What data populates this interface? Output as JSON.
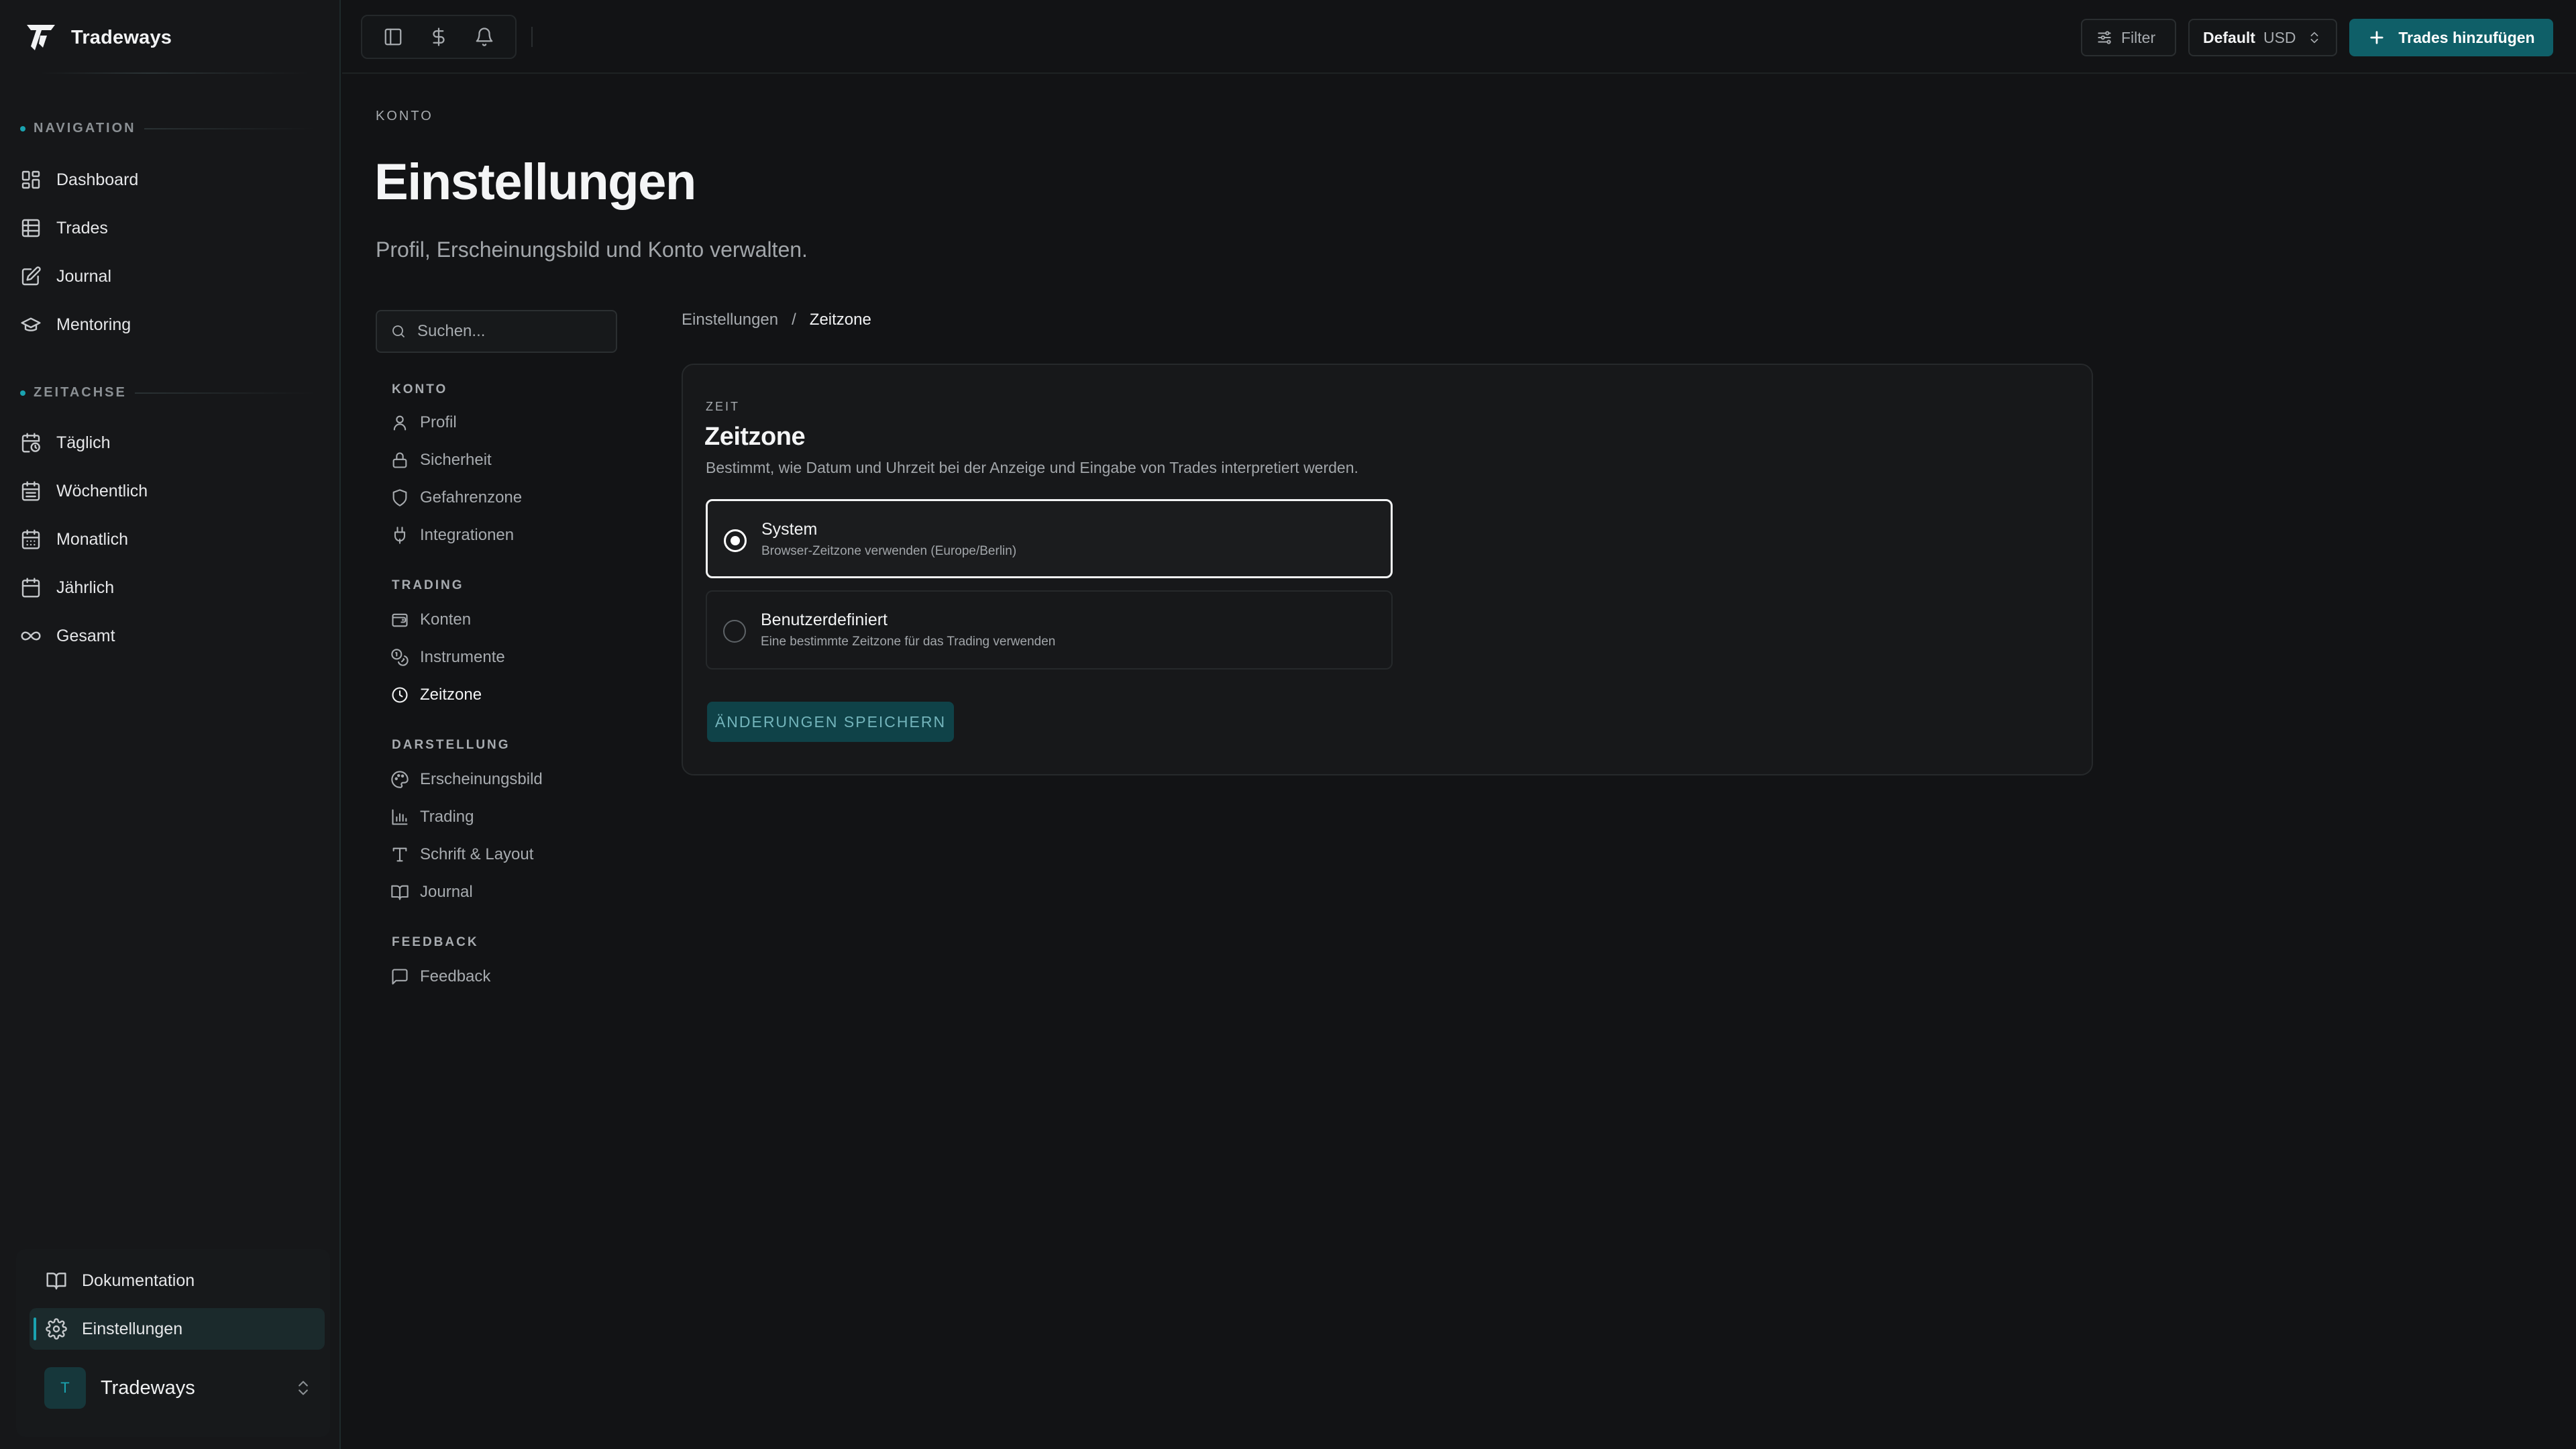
{
  "app": {
    "name": "Tradeways"
  },
  "sidebar": {
    "navigation_label": "NAVIGATION",
    "navigation": [
      {
        "label": "Dashboard",
        "icon": "dashboard-icon"
      },
      {
        "label": "Trades",
        "icon": "table-icon"
      },
      {
        "label": "Journal",
        "icon": "edit-note-icon"
      },
      {
        "label": "Mentoring",
        "icon": "graduation-cap-icon"
      }
    ],
    "timeline_label": "ZEITACHSE",
    "timeline": [
      {
        "label": "Täglich",
        "icon": "calendar-clock-icon"
      },
      {
        "label": "Wöchentlich",
        "icon": "calendar-week-icon"
      },
      {
        "label": "Monatlich",
        "icon": "calendar-month-icon"
      },
      {
        "label": "Jährlich",
        "icon": "calendar-icon"
      },
      {
        "label": "Gesamt",
        "icon": "infinity-icon"
      }
    ],
    "bottom": {
      "docs": "Dokumentation",
      "settings": "Einstellungen",
      "workspace_initial": "T",
      "workspace_name": "Tradeways"
    }
  },
  "topbar": {
    "filter": "Filter",
    "account": "Default",
    "currency": "USD",
    "add_trades": "Trades hinzufügen"
  },
  "page": {
    "eyebrow": "KONTO",
    "title": "Einstellungen",
    "subtitle": "Profil, Erscheinungsbild und Konto verwalten."
  },
  "settings_nav": {
    "search_placeholder": "Suchen...",
    "groups": [
      {
        "label": "KONTO",
        "items": [
          "Profil",
          "Sicherheit",
          "Gefahrenzone",
          "Integrationen"
        ]
      },
      {
        "label": "TRADING",
        "items": [
          "Konten",
          "Instrumente",
          "Zeitzone"
        ]
      },
      {
        "label": "DARSTELLUNG",
        "items": [
          "Erscheinungsbild",
          "Trading",
          "Schrift & Layout",
          "Journal"
        ]
      },
      {
        "label": "FEEDBACK",
        "items": [
          "Feedback"
        ]
      }
    ],
    "active": "Zeitzone"
  },
  "breadcrumb": {
    "parent": "Einstellungen",
    "separator": "/",
    "current": "Zeitzone"
  },
  "card": {
    "eyebrow": "ZEIT",
    "title": "Zeitzone",
    "description": "Bestimmt, wie Datum und Uhrzeit bei der Anzeige und Eingabe von Trades interpretiert werden.",
    "options": [
      {
        "title": "System",
        "subtitle": "Browser-Zeitzone verwenden (Europe/Berlin)",
        "selected": true
      },
      {
        "title": "Benutzerdefiniert",
        "subtitle": "Eine bestimmte Zeitzone für das Trading verwenden",
        "selected": false
      }
    ],
    "save": "ÄNDERUNGEN SPEICHERN"
  },
  "colors": {
    "accent": "#1aa3b0",
    "primary_button": "#0f5f68",
    "background": "#121315"
  }
}
